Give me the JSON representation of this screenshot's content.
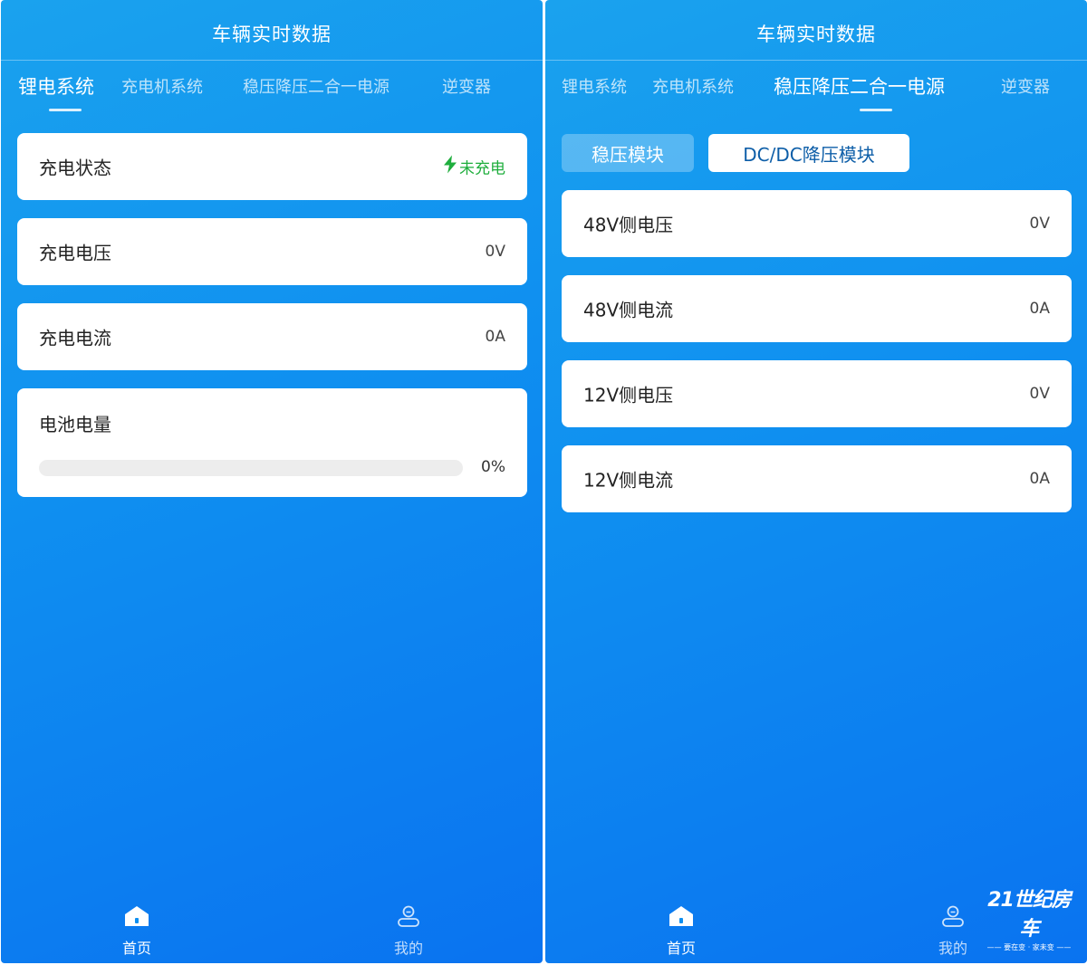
{
  "left": {
    "title": "车辆实时数据",
    "tabs": [
      "锂电系统",
      "充电机系统",
      "稳压降压二合一电源",
      "逆变器"
    ],
    "active_tab": 0,
    "cards": {
      "status_label": "充电状态",
      "status_value": "未充电",
      "voltage_label": "充电电压",
      "voltage_value": "0V",
      "current_label": "充电电流",
      "current_value": "0A",
      "battery_label": "电池电量",
      "battery_percent_text": "0%",
      "battery_level": 0
    },
    "nav": {
      "home": "首页",
      "mine": "我的"
    }
  },
  "right": {
    "title": "车辆实时数据",
    "tabs": [
      "锂电系统",
      "充电机系统",
      "稳压降压二合一电源",
      "逆变器"
    ],
    "active_tab": 2,
    "segments": [
      "稳压模块",
      "DC/DC降压模块"
    ],
    "selected_segment": 1,
    "rows": [
      {
        "label": "48V侧电压",
        "value": "0V"
      },
      {
        "label": "48V侧电流",
        "value": "0A"
      },
      {
        "label": "12V侧电压",
        "value": "0V"
      },
      {
        "label": "12V侧电流",
        "value": "0A"
      }
    ],
    "nav": {
      "home": "首页",
      "mine": "我的"
    }
  },
  "watermark": {
    "logo": "21世纪房车",
    "slogan": "—— 要在变 · 家未变 ——"
  },
  "colors": {
    "primary_blue": "#0f8ff0",
    "status_green": "#1fae3d",
    "segment_text_blue": "#0d5ea8"
  },
  "icons": {
    "bolt": "lightning-bolt-icon",
    "home": "home-icon",
    "profile": "profile-icon"
  }
}
